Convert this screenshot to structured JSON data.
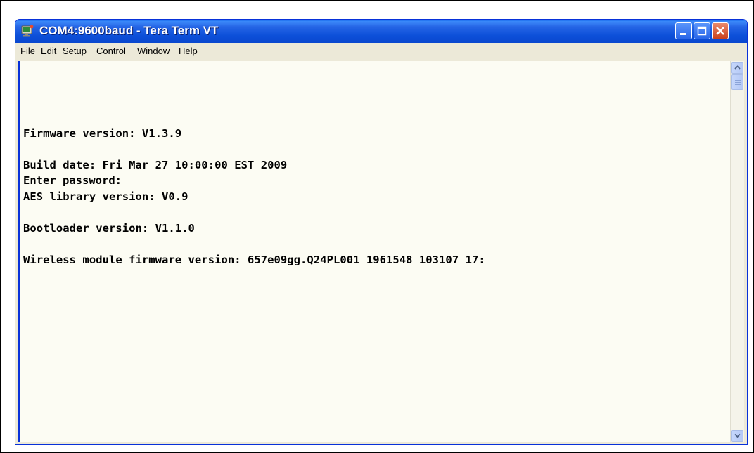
{
  "window": {
    "title": "COM4:9600baud - Tera Term VT"
  },
  "menubar": {
    "items": [
      {
        "label": "File"
      },
      {
        "label": "Edit"
      },
      {
        "label": "Setup"
      },
      {
        "label": "Control"
      },
      {
        "label": "Window"
      },
      {
        "label": "Help"
      }
    ]
  },
  "terminal": {
    "lines": [
      "Firmware version: V1.3.9",
      "Build date: Fri Mar 27 10:00:00 EST 2009",
      "AES library version: V0.9",
      "Bootloader version: V1.1.0",
      "Wireless module firmware version: 657e09gg.Q24PL001 1961548 103107 17:"
    ],
    "prompt": "Enter password:"
  },
  "icons": {
    "app": "tera-term-icon",
    "minimize": "minimize-icon",
    "maximize": "maximize-icon",
    "close": "close-icon",
    "scroll_up": "scroll-up-arrow-icon",
    "scroll_down": "scroll-down-arrow-icon"
  },
  "colors": {
    "titlebar": "#2666e6",
    "terminal_bg": "#fcfcf3",
    "close_button": "#c9401c"
  }
}
